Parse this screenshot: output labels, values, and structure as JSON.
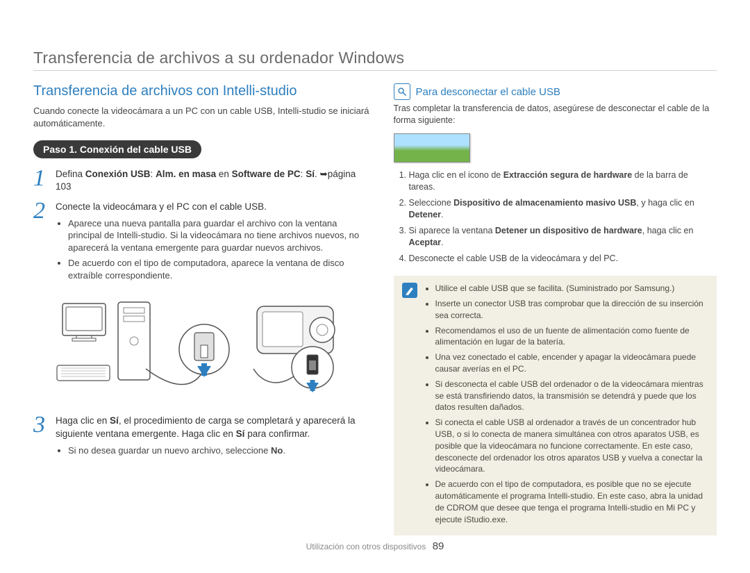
{
  "page_header": "Transferencia de archivos a su ordenador Windows",
  "left": {
    "section_title": "Transferencia de archivos con Intelli-studio",
    "intro": "Cuando conecte la videocámara a un PC con un cable USB, Intelli-studio se iniciará automáticamente.",
    "step_pill": "Paso 1. Conexión del cable USB",
    "s1": {
      "pre": "Defina ",
      "b1": "Conexión USB",
      "mid1": ": ",
      "b2": "Alm. en masa",
      "mid2": " en ",
      "b3": "Software de PC",
      "mid3": ": ",
      "b4": "Sí",
      "post": ". ➥página 103"
    },
    "s2_text": "Conecte la videocámara y el PC con el cable USB.",
    "s2_bullets": [
      "Aparece una nueva pantalla para guardar el archivo con la ventana principal de Intelli-studio. Si la videocámara no tiene archivos nuevos, no aparecerá la ventana emergente para guardar nuevos archivos.",
      "De acuerdo con el tipo de computadora, aparece la ventana de disco extraíble correspondiente."
    ],
    "s3": {
      "pre": "Haga clic en ",
      "b1": "Sí",
      "mid1": ", el procedimiento de carga se completará y aparecerá la siguiente ventana emergente. Haga clic en ",
      "b2": "Sí",
      "post": " para confirmar."
    },
    "s3_bullet_pre": "Si no desea guardar un nuevo archivo, seleccione ",
    "s3_bullet_b": "No",
    "s3_bullet_post": "."
  },
  "right": {
    "section_title": "Para desconectar el cable USB",
    "intro": "Tras completar la transferencia de datos, asegúrese de desconectar el cable de la forma siguiente:",
    "ol": [
      {
        "pre": "Haga clic en el icono de ",
        "b": "Extracción segura de hardware",
        "post": " de la barra de tareas."
      },
      {
        "pre": "Seleccione ",
        "b": "Dispositivo de almacenamiento masivo USB",
        "mid": ", y haga clic en ",
        "b2": "Detener",
        "post": "."
      },
      {
        "pre": "Si aparece la ventana ",
        "b": "Detener un dispositivo de hardware",
        "mid": ", haga clic en ",
        "b2": "Aceptar",
        "post": "."
      },
      {
        "pre": "Desconecte el cable USB de la videocámara y del PC.",
        "b": "",
        "post": ""
      }
    ],
    "notes": [
      "Utilice el cable USB que se facilita. (Suministrado por Samsung.)",
      "Inserte un conector USB tras comprobar que la dirección de su inserción sea correcta.",
      "Recomendamos el uso de un fuente de alimentación como fuente de alimentación en lugar de la batería.",
      "Una vez conectado el cable, encender y apagar la videocámara puede causar averías en el PC.",
      "Si desconecta el cable USB del ordenador o de la videocámara mientras se está transfiriendo datos, la transmisión se detendrá y puede que los datos resulten dañados.",
      "Si conecta el cable USB al ordenador a través de un concentrador hub USB, o si lo conecta de manera simultánea con otros aparatos USB, es posible que la videocámara no funcione correctamente. En este caso, desconecte del ordenador los otros aparatos USB y vuelva a conectar la videocámara.",
      "De acuerdo con el tipo de computadora, es posible que no se ejecute automáticamente el programa Intelli-studio. En este caso, abra la unidad de CDROM que desee que tenga el programa Intelli-studio en Mi PC y ejecute iStudio.exe."
    ]
  },
  "footer_text": "Utilización con otros dispositivos",
  "page_number": "89"
}
